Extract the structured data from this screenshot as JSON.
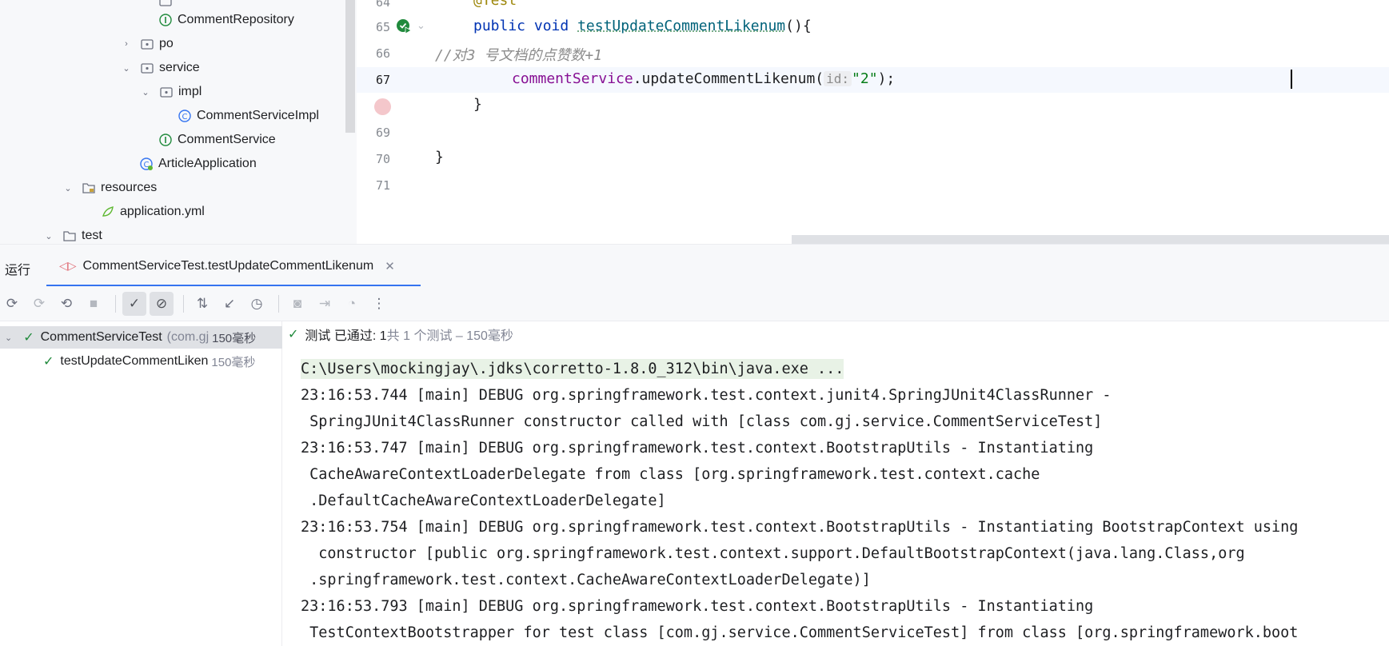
{
  "project_tree": {
    "items": [
      {
        "label": "CommentRepository",
        "type": "interface"
      },
      {
        "label": "po",
        "type": "package"
      },
      {
        "label": "service",
        "type": "package"
      },
      {
        "label": "impl",
        "type": "package"
      },
      {
        "label": "CommentServiceImpl",
        "type": "class"
      },
      {
        "label": "CommentService",
        "type": "interface"
      },
      {
        "label": "ArticleApplication",
        "type": "spring-class"
      },
      {
        "label": "resources",
        "type": "resources-folder"
      },
      {
        "label": "application.yml",
        "type": "yaml-file"
      },
      {
        "label": "test",
        "type": "folder"
      }
    ]
  },
  "editor": {
    "line_numbers": [
      "64",
      "65",
      "66",
      "67",
      "69",
      "70",
      "71"
    ],
    "line_64": "@Test",
    "line_65_kw": "public void",
    "line_65_method": "testUpdateCommentLikenum",
    "line_65_rest": "(){",
    "line_66_comment": "//对3 号文档的点赞数+1",
    "line_67_field": "commentService",
    "line_67_call": ".updateCommentLikenum(",
    "line_67_hint": "id:",
    "line_67_arg": "\"2\"",
    "line_67_end": ");",
    "line_68": "}",
    "line_70": "}"
  },
  "run": {
    "title": "运行",
    "tab_label": "CommentServiceTest.testUpdateCommentLikenum",
    "test_tree": {
      "root_label": "CommentServiceTest",
      "root_package": "(com.gj",
      "root_duration": "150毫秒",
      "child_label": "testUpdateCommentLiken",
      "child_duration": "150毫秒"
    },
    "status": {
      "prefix": "测试 已通过: 1",
      "summary": "共 1 个测试 – 150毫秒"
    },
    "console_lines": [
      "C:\\Users\\mockingjay\\.jdks\\corretto-1.8.0_312\\bin\\java.exe ...",
      "23:16:53.744 [main] DEBUG org.springframework.test.context.junit4.SpringJUnit4ClassRunner -",
      " SpringJUnit4ClassRunner constructor called with [class com.gj.service.CommentServiceTest]",
      "23:16:53.747 [main] DEBUG org.springframework.test.context.BootstrapUtils - Instantiating",
      " CacheAwareContextLoaderDelegate from class [org.springframework.test.context.cache",
      " .DefaultCacheAwareContextLoaderDelegate]",
      "23:16:53.754 [main] DEBUG org.springframework.test.context.BootstrapUtils - Instantiating BootstrapContext using",
      "  constructor [public org.springframework.test.context.support.DefaultBootstrapContext(java.lang.Class,org",
      " .springframework.test.context.CacheAwareContextLoaderDelegate)]",
      "23:16:53.793 [main] DEBUG org.springframework.test.context.BootstrapUtils - Instantiating",
      " TestContextBootstrapper for test class [com.gj.service.CommentServiceTest] from class [org.springframework.boot"
    ]
  },
  "colors": {
    "accent": "#3574f0",
    "pass_green": "#208a3c",
    "keyword": "#0033b3",
    "method": "#00627a",
    "field": "#871094",
    "string": "#067d17"
  }
}
